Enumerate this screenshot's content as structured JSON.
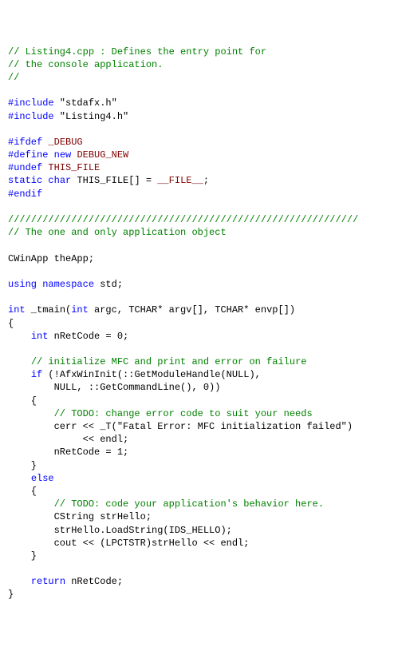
{
  "lines": [
    {
      "spans": [
        {
          "cls": "c",
          "text": "// Listing4.cpp : Defines the entry point for"
        }
      ]
    },
    {
      "spans": [
        {
          "cls": "c",
          "text": "// the console application."
        }
      ]
    },
    {
      "spans": [
        {
          "cls": "c",
          "text": "//"
        }
      ]
    },
    {
      "spans": [
        {
          "cls": "t",
          "text": ""
        }
      ]
    },
    {
      "spans": [
        {
          "cls": "pp",
          "text": "#include"
        },
        {
          "cls": "t",
          "text": " \"stdafx.h\""
        }
      ]
    },
    {
      "spans": [
        {
          "cls": "pp",
          "text": "#include"
        },
        {
          "cls": "t",
          "text": " \"Listing4.h\""
        }
      ]
    },
    {
      "spans": [
        {
          "cls": "t",
          "text": ""
        }
      ]
    },
    {
      "spans": [
        {
          "cls": "pp",
          "text": "#ifdef"
        },
        {
          "cls": "t",
          "text": " "
        },
        {
          "cls": "m",
          "text": "_DEBUG"
        }
      ]
    },
    {
      "spans": [
        {
          "cls": "pp",
          "text": "#define"
        },
        {
          "cls": "t",
          "text": " "
        },
        {
          "cls": "k",
          "text": "new"
        },
        {
          "cls": "t",
          "text": " "
        },
        {
          "cls": "m",
          "text": "DEBUG_NEW"
        }
      ]
    },
    {
      "spans": [
        {
          "cls": "pp",
          "text": "#undef"
        },
        {
          "cls": "t",
          "text": " "
        },
        {
          "cls": "m",
          "text": "THIS_FILE"
        }
      ]
    },
    {
      "spans": [
        {
          "cls": "k",
          "text": "static"
        },
        {
          "cls": "t",
          "text": " "
        },
        {
          "cls": "k",
          "text": "char"
        },
        {
          "cls": "t",
          "text": " THIS_FILE[] = "
        },
        {
          "cls": "m",
          "text": "__FILE__"
        },
        {
          "cls": "t",
          "text": ";"
        }
      ]
    },
    {
      "spans": [
        {
          "cls": "pp",
          "text": "#endif"
        }
      ]
    },
    {
      "spans": [
        {
          "cls": "t",
          "text": ""
        }
      ]
    },
    {
      "spans": [
        {
          "cls": "c",
          "text": "/////////////////////////////////////////////////////////////"
        }
      ]
    },
    {
      "spans": [
        {
          "cls": "c",
          "text": "// The one and only application object"
        }
      ]
    },
    {
      "spans": [
        {
          "cls": "t",
          "text": ""
        }
      ]
    },
    {
      "spans": [
        {
          "cls": "t",
          "text": "CWinApp theApp;"
        }
      ]
    },
    {
      "spans": [
        {
          "cls": "t",
          "text": ""
        }
      ]
    },
    {
      "spans": [
        {
          "cls": "k",
          "text": "using"
        },
        {
          "cls": "t",
          "text": " "
        },
        {
          "cls": "k",
          "text": "namespace"
        },
        {
          "cls": "t",
          "text": " std;"
        }
      ]
    },
    {
      "spans": [
        {
          "cls": "t",
          "text": ""
        }
      ]
    },
    {
      "spans": [
        {
          "cls": "k",
          "text": "int"
        },
        {
          "cls": "t",
          "text": " _tmain("
        },
        {
          "cls": "k",
          "text": "int"
        },
        {
          "cls": "t",
          "text": " argc, TCHAR* argv[], TCHAR* envp[])"
        }
      ]
    },
    {
      "spans": [
        {
          "cls": "t",
          "text": "{"
        }
      ]
    },
    {
      "spans": [
        {
          "cls": "t",
          "text": "    "
        },
        {
          "cls": "k",
          "text": "int"
        },
        {
          "cls": "t",
          "text": " nRetCode = 0;"
        }
      ]
    },
    {
      "spans": [
        {
          "cls": "t",
          "text": ""
        }
      ]
    },
    {
      "spans": [
        {
          "cls": "t",
          "text": "    "
        },
        {
          "cls": "c",
          "text": "// initialize MFC and print and error on failure"
        }
      ]
    },
    {
      "spans": [
        {
          "cls": "t",
          "text": "    "
        },
        {
          "cls": "k",
          "text": "if"
        },
        {
          "cls": "t",
          "text": " (!AfxWinInit(::GetModuleHandle(NULL),"
        }
      ]
    },
    {
      "spans": [
        {
          "cls": "t",
          "text": "        NULL, ::GetCommandLine(), 0))"
        }
      ]
    },
    {
      "spans": [
        {
          "cls": "t",
          "text": "    {"
        }
      ]
    },
    {
      "spans": [
        {
          "cls": "t",
          "text": "        "
        },
        {
          "cls": "c",
          "text": "// TODO: change error code to suit your needs"
        }
      ]
    },
    {
      "spans": [
        {
          "cls": "t",
          "text": "        cerr << _T(\"Fatal Error: MFC initialization failed\")"
        }
      ]
    },
    {
      "spans": [
        {
          "cls": "t",
          "text": "             << endl;"
        }
      ]
    },
    {
      "spans": [
        {
          "cls": "t",
          "text": "        nRetCode = 1;"
        }
      ]
    },
    {
      "spans": [
        {
          "cls": "t",
          "text": "    }"
        }
      ]
    },
    {
      "spans": [
        {
          "cls": "t",
          "text": "    "
        },
        {
          "cls": "k",
          "text": "else"
        }
      ]
    },
    {
      "spans": [
        {
          "cls": "t",
          "text": "    {"
        }
      ]
    },
    {
      "spans": [
        {
          "cls": "t",
          "text": "        "
        },
        {
          "cls": "c",
          "text": "// TODO: code your application's behavior here."
        }
      ]
    },
    {
      "spans": [
        {
          "cls": "t",
          "text": "        CString strHello;"
        }
      ]
    },
    {
      "spans": [
        {
          "cls": "t",
          "text": "        strHello.LoadString(IDS_HELLO);"
        }
      ]
    },
    {
      "spans": [
        {
          "cls": "t",
          "text": "        cout << (LPCTSTR)strHello << endl;"
        }
      ]
    },
    {
      "spans": [
        {
          "cls": "t",
          "text": "    }"
        }
      ]
    },
    {
      "spans": [
        {
          "cls": "t",
          "text": ""
        }
      ]
    },
    {
      "spans": [
        {
          "cls": "t",
          "text": "    "
        },
        {
          "cls": "k",
          "text": "return"
        },
        {
          "cls": "t",
          "text": " nRetCode;"
        }
      ]
    },
    {
      "spans": [
        {
          "cls": "t",
          "text": "}"
        }
      ]
    }
  ]
}
